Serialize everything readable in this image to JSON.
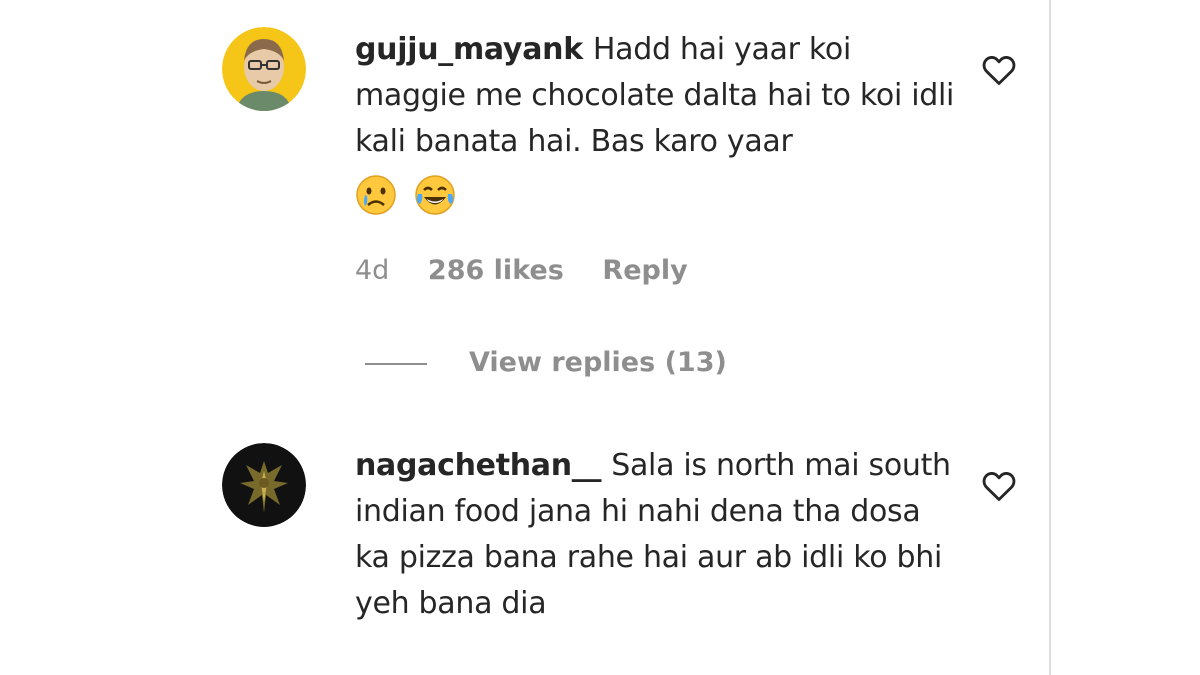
{
  "comments": [
    {
      "username": "gujju_mayank",
      "text": "Hadd hai yaar koi maggie me chocolate dalta hai to koi idli kali banata hai. Bas karo yaar",
      "emojis": [
        "crying-face-emoji",
        "tears-of-joy-emoji"
      ],
      "age": "4d",
      "likes": "286 likes",
      "reply_label": "Reply",
      "view_replies_label": "View replies (13)"
    },
    {
      "username": "nagachethan__",
      "text": "Sala is north mai south indian food jana hi nahi dena tha dosa ka pizza bana rahe hai aur ab idli ko bhi yeh bana dia"
    }
  ],
  "icons": {
    "like": "heart-outline-icon"
  },
  "colors": {
    "text_primary": "#262626",
    "text_secondary": "#8e8e8e",
    "avatar1_bg": "#f5c518",
    "avatar2_bg": "#111111"
  }
}
